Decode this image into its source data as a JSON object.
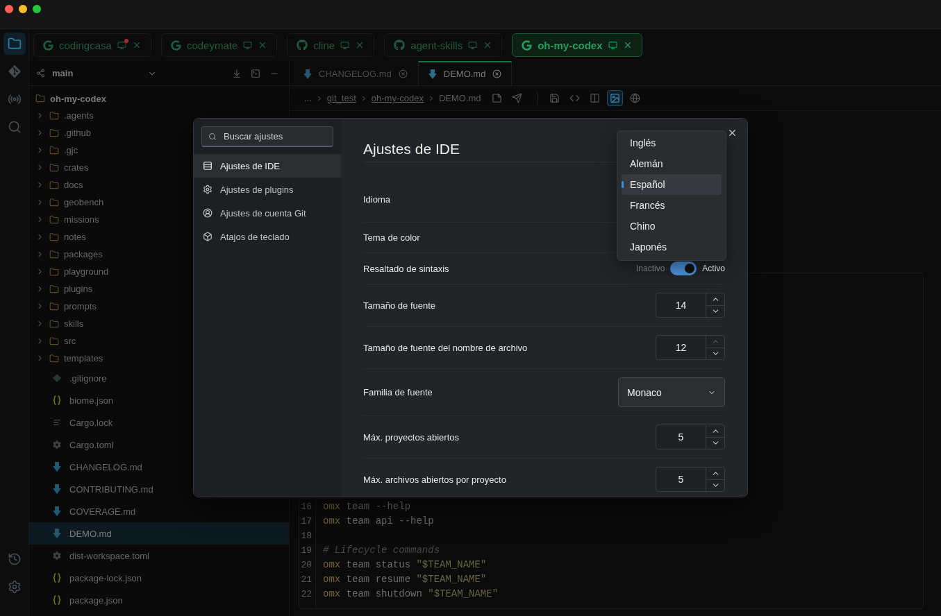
{
  "activity_bar": {
    "top": [
      {
        "kind": "explorer",
        "selected": true
      },
      {
        "kind": "git",
        "selected": false
      },
      {
        "kind": "remote",
        "selected": false
      },
      {
        "kind": "search",
        "selected": false
      }
    ],
    "bottom": [
      {
        "kind": "history",
        "selected": false
      },
      {
        "kind": "settings",
        "selected": false
      }
    ]
  },
  "project_tabs": [
    {
      "label": "codingcasa",
      "kind": "g",
      "selected": false,
      "notification": true
    },
    {
      "label": "codeymate",
      "kind": "g",
      "selected": false,
      "notification": false
    },
    {
      "label": "cline",
      "kind": "octocat",
      "selected": false,
      "notification": false
    },
    {
      "label": "agent-skills",
      "kind": "octocat",
      "selected": false,
      "notification": false
    },
    {
      "label": "oh-my-codex",
      "kind": "g",
      "selected": true,
      "notification": false
    }
  ],
  "sidebar": {
    "branch": "main",
    "tree": {
      "label": "oh-my-codex",
      "children": [
        {
          "label": ".agents",
          "kind": "folder",
          "expanded": false,
          "selected": false
        },
        {
          "label": ".github",
          "kind": "folder",
          "expanded": false,
          "selected": false
        },
        {
          "label": ".gjc",
          "kind": "folder",
          "expanded": false,
          "selected": false
        },
        {
          "label": "crates",
          "kind": "folder",
          "expanded": false,
          "selected": false
        },
        {
          "label": "docs",
          "kind": "folder",
          "expanded": false,
          "selected": false
        },
        {
          "label": "geobench",
          "kind": "folder",
          "expanded": false,
          "selected": false
        },
        {
          "label": "missions",
          "kind": "folder",
          "expanded": false,
          "selected": false
        },
        {
          "label": "notes",
          "kind": "folder",
          "expanded": false,
          "selected": false
        },
        {
          "label": "packages",
          "kind": "folder",
          "expanded": false,
          "selected": false
        },
        {
          "label": "playground",
          "kind": "folder",
          "expanded": false,
          "selected": false
        },
        {
          "label": "plugins",
          "kind": "folder",
          "expanded": false,
          "selected": false
        },
        {
          "label": "prompts",
          "kind": "folder",
          "expanded": false,
          "selected": false
        },
        {
          "label": "skills",
          "kind": "folder",
          "expanded": false,
          "selected": false
        },
        {
          "label": "src",
          "kind": "folder",
          "expanded": false,
          "selected": false
        },
        {
          "label": "templates",
          "kind": "folder",
          "expanded": false,
          "selected": false
        },
        {
          "label": ".gitignore",
          "kind": "gitignore",
          "selected": false
        },
        {
          "label": "biome.json",
          "kind": "json",
          "selected": false
        },
        {
          "label": "Cargo.lock",
          "kind": "lock",
          "selected": false
        },
        {
          "label": "Cargo.toml",
          "kind": "toml",
          "selected": false
        },
        {
          "label": "CHANGELOG.md",
          "kind": "markdown",
          "selected": false
        },
        {
          "label": "CONTRIBUTING.md",
          "kind": "markdown",
          "selected": false
        },
        {
          "label": "COVERAGE.md",
          "kind": "markdown",
          "selected": false
        },
        {
          "label": "DEMO.md",
          "kind": "markdown",
          "selected": true
        },
        {
          "label": "dist-workspace.toml",
          "kind": "toml",
          "selected": false
        },
        {
          "label": "package-lock.json",
          "kind": "json",
          "selected": false
        },
        {
          "label": "package.json",
          "kind": "json",
          "selected": false
        }
      ]
    }
  },
  "editor": {
    "tabs": [
      {
        "label": "CHANGELOG.md",
        "selected": false
      },
      {
        "label": "DEMO.md",
        "selected": true
      }
    ],
    "breadcrumbs": [
      {
        "label": "...",
        "kind": "text"
      },
      {
        "label": "git_test",
        "kind": "link"
      },
      {
        "label": "oh-my-codex",
        "kind": "link"
      },
      {
        "label": "DEMO.md",
        "kind": "text"
      }
    ],
    "toolbar": [
      [
        {
          "kind": "note",
          "selected": false
        },
        {
          "kind": "send",
          "selected": false
        }
      ],
      [
        {
          "kind": "save",
          "selected": false
        },
        {
          "kind": "code",
          "selected": false
        },
        {
          "kind": "split",
          "selected": false
        },
        {
          "kind": "preview",
          "selected": true
        },
        {
          "kind": "globe",
          "selected": false
        }
      ]
    ],
    "code_lines": [
      {
        "number": "16",
        "tokens": [
          {
            "kind": "command",
            "text": "omx"
          },
          {
            "kind": "plain",
            "text": " team --help"
          }
        ]
      },
      {
        "number": "17",
        "tokens": [
          {
            "kind": "command",
            "text": "omx"
          },
          {
            "kind": "plain",
            "text": " team api --help"
          }
        ]
      },
      {
        "number": "18"
      },
      {
        "number": "19",
        "tokens": [
          {
            "kind": "comment",
            "text": "# Lifecycle commands"
          }
        ]
      },
      {
        "number": "20",
        "tokens": [
          {
            "kind": "command",
            "text": "omx"
          },
          {
            "kind": "plain",
            "text": " team status "
          },
          {
            "kind": "string",
            "text": "\"$TEAM_NAME\""
          }
        ]
      },
      {
        "number": "21",
        "tokens": [
          {
            "kind": "command",
            "text": "omx"
          },
          {
            "kind": "plain",
            "text": " team resume "
          },
          {
            "kind": "string",
            "text": "\"$TEAM_NAME\""
          }
        ]
      },
      {
        "number": "22",
        "tokens": [
          {
            "kind": "command",
            "text": "omx"
          },
          {
            "kind": "plain",
            "text": " team shutdown "
          },
          {
            "kind": "string",
            "text": "\"$TEAM_NAME\""
          }
        ]
      }
    ]
  },
  "settings_dialog": {
    "search": {
      "placeholder": "Buscar ajustes"
    },
    "nav": [
      {
        "label": "Ajustes de IDE",
        "kind": "list",
        "selected": true
      },
      {
        "label": "Ajustes de plugins",
        "kind": "gear",
        "selected": false
      },
      {
        "label": "Ajustes de cuenta Git",
        "kind": "user",
        "selected": false
      },
      {
        "label": "Atajos de teclado",
        "kind": "cube",
        "selected": false
      }
    ],
    "title": "Ajustes de IDE",
    "rows": [
      {
        "label": "Idioma",
        "kind": "menu",
        "options": [
          {
            "label": "Inglés",
            "selected": false
          },
          {
            "label": "Alemán",
            "selected": false
          },
          {
            "label": "Español",
            "selected": true
          },
          {
            "label": "Francés",
            "selected": false
          },
          {
            "label": "Chino",
            "selected": false
          },
          {
            "label": "Japonés",
            "selected": false
          }
        ]
      },
      {
        "label": "Tema de color",
        "kind": "label"
      },
      {
        "label": "Resaltado de sintaxis",
        "kind": "toggle",
        "on": true,
        "off_label": "Inactivo",
        "on_label": "Activo"
      },
      {
        "label": "Tamaño de fuente",
        "kind": "number",
        "value": "14",
        "increment_disabled": false
      },
      {
        "label": "Tamaño de fuente del nombre de archivo",
        "kind": "number",
        "value": "12",
        "increment_disabled": true
      },
      {
        "label": "Familia de fuente",
        "kind": "select",
        "value": "Monaco"
      },
      {
        "label": "Máx. proyectos abiertos",
        "kind": "number",
        "value": "5",
        "increment_disabled": false
      },
      {
        "label": "Máx. archivos abiertos por proyecto",
        "kind": "number",
        "value": "5",
        "increment_disabled": false
      }
    ]
  }
}
